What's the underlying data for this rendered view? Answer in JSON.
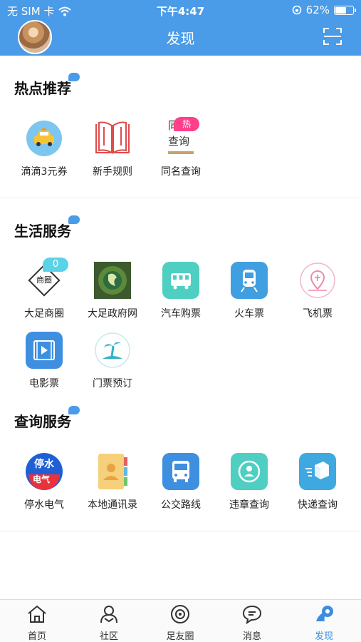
{
  "status_bar": {
    "carrier": "无 SIM 卡",
    "time": "下午4:47",
    "battery": "62%",
    "battery_level": 0.62
  },
  "nav": {
    "title": "发现"
  },
  "sections": {
    "hot": {
      "title": "热点推荐",
      "items": [
        {
          "label": "滴滴3元券",
          "icon": "taxi-icon"
        },
        {
          "label": "新手规则",
          "icon": "book-icon"
        },
        {
          "label": "同名查询",
          "icon": "name-query-icon",
          "icon_text_1": "同",
          "icon_text_2": "查询",
          "badge": "热"
        }
      ]
    },
    "life": {
      "title": "生活服务",
      "items": [
        {
          "label": "大足商圈",
          "icon": "business-district-icon",
          "icon_text": "商圈",
          "badge": "0"
        },
        {
          "label": "大足政府网",
          "icon": "government-site-icon"
        },
        {
          "label": "汽车购票",
          "icon": "bus-ticket-icon"
        },
        {
          "label": "火车票",
          "icon": "train-ticket-icon"
        },
        {
          "label": "飞机票",
          "icon": "plane-ticket-icon"
        },
        {
          "label": "电影票",
          "icon": "movie-ticket-icon"
        },
        {
          "label": "门票预订",
          "icon": "attraction-ticket-icon"
        }
      ]
    },
    "query": {
      "title": "查询服务",
      "items": [
        {
          "label": "停水电气",
          "icon": "utilities-icon",
          "icon_text_1": "停水",
          "icon_text_2": "电气"
        },
        {
          "label": "本地通讯录",
          "icon": "contacts-icon"
        },
        {
          "label": "公交路线",
          "icon": "bus-route-icon"
        },
        {
          "label": "违章查询",
          "icon": "violation-query-icon"
        },
        {
          "label": "快递查询",
          "icon": "express-query-icon"
        }
      ]
    }
  },
  "tabbar": [
    {
      "label": "首页",
      "icon": "home-icon"
    },
    {
      "label": "社区",
      "icon": "community-icon"
    },
    {
      "label": "足友圈",
      "icon": "friends-circle-icon"
    },
    {
      "label": "消息",
      "icon": "message-icon"
    },
    {
      "label": "发现",
      "icon": "discover-icon",
      "active": true
    }
  ],
  "colors": {
    "brand": "#4a9be8",
    "hot_badge": "#ff3f8a",
    "num_badge": "#5bd2e8",
    "active_tab": "#3a8ee0"
  }
}
